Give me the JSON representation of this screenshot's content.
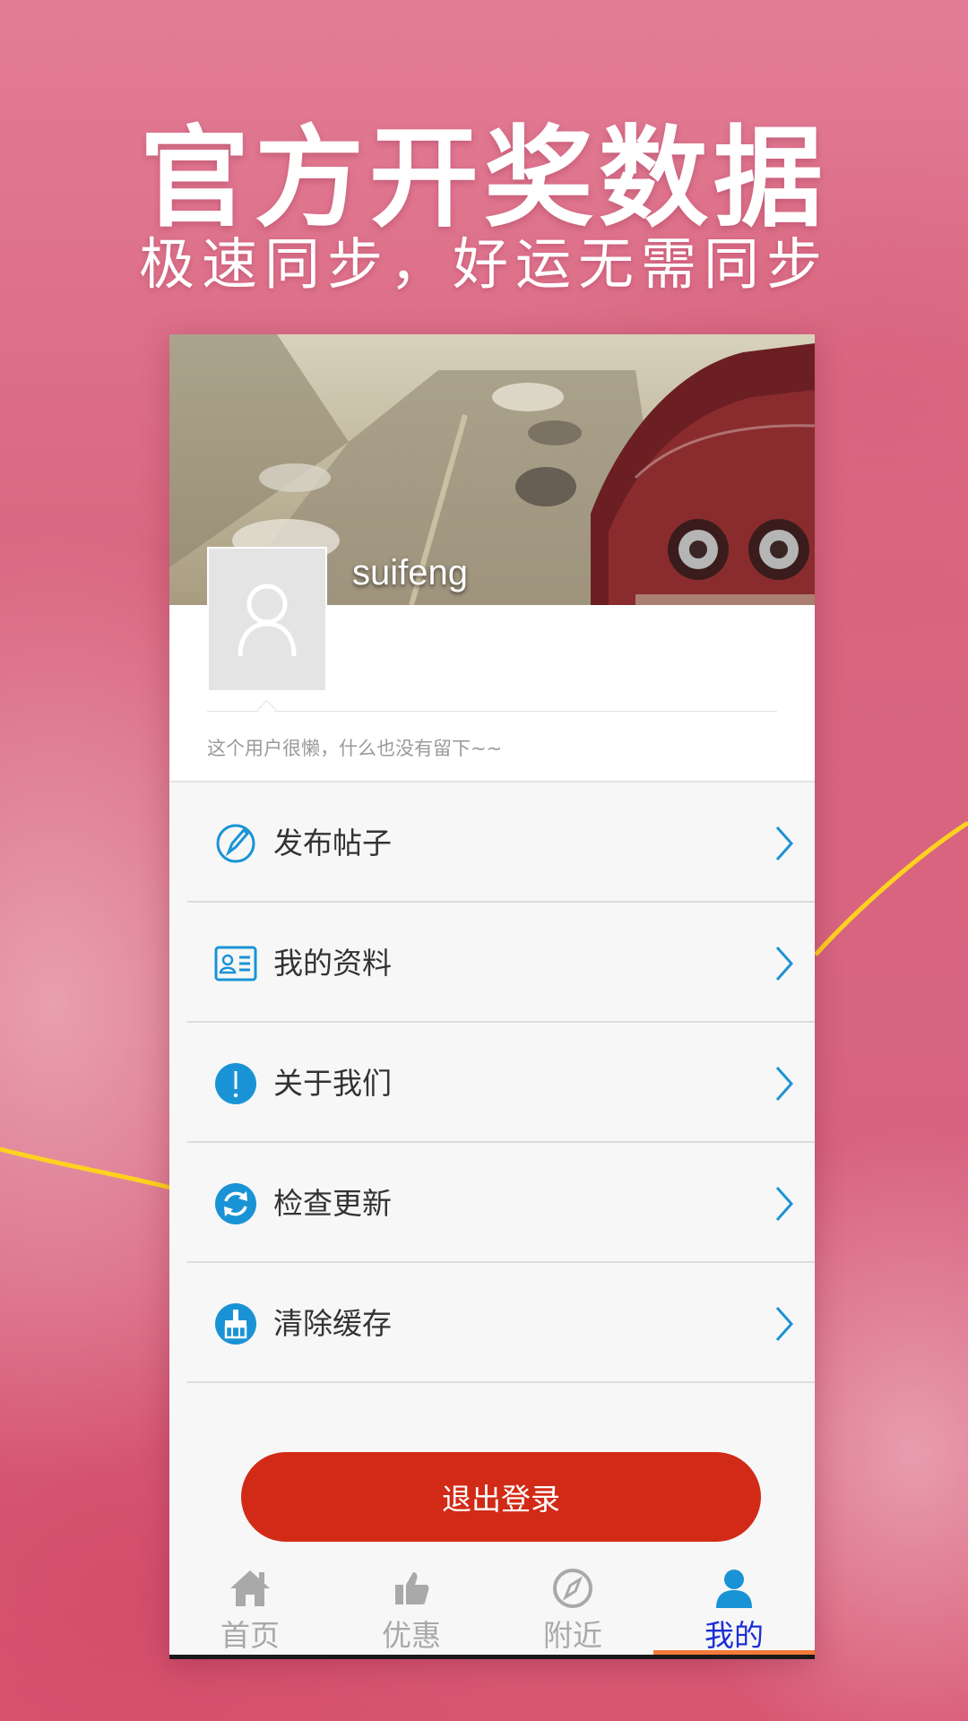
{
  "promo": {
    "headline": "官方开奖数据",
    "subline": "极速同步，好运无需同步"
  },
  "profile": {
    "username": "suifeng",
    "bio": "这个用户很懒，什么也没有留下~~"
  },
  "menu": {
    "items": [
      {
        "label": "发布帖子",
        "icon": "edit-pen-icon"
      },
      {
        "label": "我的资料",
        "icon": "profile-card-icon"
      },
      {
        "label": "关于我们",
        "icon": "info-exclamation-icon"
      },
      {
        "label": "检查更新",
        "icon": "refresh-icon"
      },
      {
        "label": "清除缓存",
        "icon": "broom-icon"
      }
    ]
  },
  "logout": {
    "label": "退出登录"
  },
  "tabbar": {
    "tabs": [
      {
        "label": "首页",
        "icon": "home-icon"
      },
      {
        "label": "优惠",
        "icon": "thumbs-up-icon"
      },
      {
        "label": "附近",
        "icon": "compass-icon"
      },
      {
        "label": "我的",
        "icon": "user-icon"
      }
    ],
    "active_tab": "我的"
  },
  "colors": {
    "accent_blue": "#1a93d6",
    "logout_red": "#d12b17",
    "active_tab_text": "#1a2fd6",
    "tab_indicator": "#f47a3a"
  }
}
